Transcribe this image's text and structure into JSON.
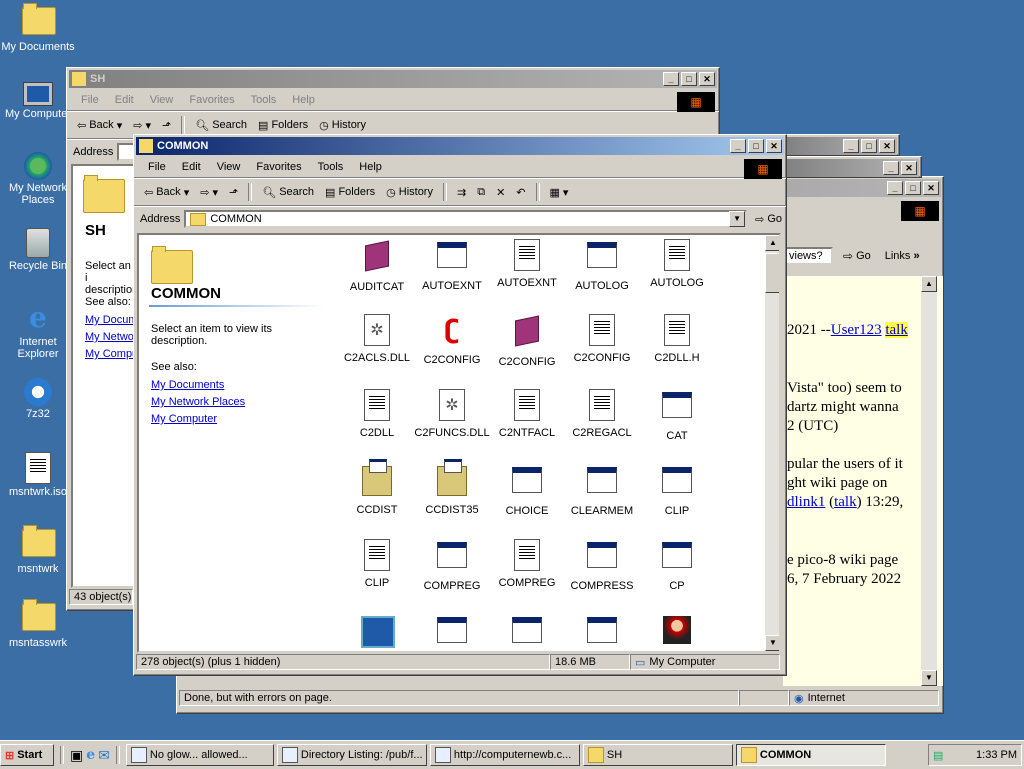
{
  "desktop_icons": [
    {
      "label": "My Documents",
      "icon": "folder-docs-icon"
    },
    {
      "label": "My Computer",
      "icon": "computer-icon"
    },
    {
      "label": "My Network Places",
      "icon": "network-icon"
    },
    {
      "label": "Recycle Bin",
      "icon": "recycle-bin-icon"
    },
    {
      "label": "Internet Explorer",
      "icon": "ie-icon"
    },
    {
      "label": "7z32",
      "icon": "installer-icon"
    },
    {
      "label": "msntwrk.iso",
      "icon": "iso-icon"
    },
    {
      "label": "msntwrk",
      "icon": "folder-icon"
    },
    {
      "label": "msntasswrk",
      "icon": "folder-icon"
    }
  ],
  "sh_window": {
    "title": "SH",
    "menu": [
      "File",
      "Edit",
      "View",
      "Favorites",
      "Tools",
      "Help"
    ],
    "toolbar": {
      "back": "Back",
      "search": "Search",
      "folders": "Folders",
      "history": "History"
    },
    "address_label": "Address",
    "panel_title": "SH",
    "panel_desc": "Select an i description",
    "see_also": "See also:",
    "links": [
      "My Docum",
      "My Netwo",
      "My Compu"
    ],
    "status": "43 object(s)"
  },
  "browser_window": {
    "address_hint": "views?",
    "go": "Go",
    "links": "Links",
    "text_lines": [
      {
        "pre": "2021 --",
        "link": "User123",
        "post": " ",
        "talk": "talk"
      },
      {
        "pre": "Vista\" too) seem to"
      },
      {
        "pre": "dartz might wanna"
      },
      {
        "pre": "2 (UTC)"
      },
      {
        "pre": "pular the users of it"
      },
      {
        "pre": "ght wiki page on"
      },
      {
        "pre": "",
        "link": "dlink1",
        "post": " (",
        "talk": "talk",
        "post2": ") 13:29,"
      },
      {
        "pre": "e pico-8 wiki page"
      },
      {
        "pre": "6, 7 February 2022"
      }
    ],
    "status": "Done, but with errors on page.",
    "zone": "Internet"
  },
  "common_window": {
    "title": "COMMON",
    "menu": [
      "File",
      "Edit",
      "View",
      "Favorites",
      "Tools",
      "Help"
    ],
    "toolbar": {
      "back": "Back",
      "search": "Search",
      "folders": "Folders",
      "history": "History"
    },
    "address_label": "Address",
    "address_value": "COMMON",
    "go": "Go",
    "panel_title": "COMMON",
    "panel_desc": "Select an item to view its description.",
    "see_also": "See also:",
    "links": [
      "My Documents",
      "My Network Places",
      "My Computer"
    ],
    "files": [
      {
        "name": "AUDITCAT",
        "type": "book"
      },
      {
        "name": "AUTOEXNT",
        "type": "app"
      },
      {
        "name": "AUTOEXNT",
        "type": "doc"
      },
      {
        "name": "AUTOLOG",
        "type": "app"
      },
      {
        "name": "AUTOLOG",
        "type": "doc"
      },
      {
        "name": "C2ACLS.DLL",
        "type": "gear"
      },
      {
        "name": "C2CONFIG",
        "type": "c2"
      },
      {
        "name": "C2CONFIG",
        "type": "book"
      },
      {
        "name": "C2CONFIG",
        "type": "doc"
      },
      {
        "name": "C2DLL.H",
        "type": "doc"
      },
      {
        "name": "C2DLL",
        "type": "doc"
      },
      {
        "name": "C2FUNCS.DLL",
        "type": "gear"
      },
      {
        "name": "C2NTFACL",
        "type": "doc"
      },
      {
        "name": "C2REGACL",
        "type": "doc"
      },
      {
        "name": "CAT",
        "type": "app"
      },
      {
        "name": "CCDIST",
        "type": "box"
      },
      {
        "name": "CCDIST35",
        "type": "box"
      },
      {
        "name": "CHOICE",
        "type": "app"
      },
      {
        "name": "CLEARMEM",
        "type": "app"
      },
      {
        "name": "CLIP",
        "type": "app"
      },
      {
        "name": "CLIP",
        "type": "doc"
      },
      {
        "name": "COMPREG",
        "type": "app"
      },
      {
        "name": "COMPREG",
        "type": "doc"
      },
      {
        "name": "COMPRESS",
        "type": "app"
      },
      {
        "name": "CP",
        "type": "app"
      },
      {
        "name": "",
        "type": "cubes"
      },
      {
        "name": "",
        "type": "app"
      },
      {
        "name": "",
        "type": "app"
      },
      {
        "name": "",
        "type": "app"
      },
      {
        "name": "",
        "type": "person"
      }
    ],
    "status_objects": "278 object(s) (plus 1 hidden)",
    "status_size": "18.6 MB",
    "status_zone": "My Computer"
  },
  "taskbar": {
    "start": "Start",
    "tasks": [
      "No glow... allowed...",
      "Directory Listing: /pub/f...",
      "http://computernewb.c...",
      "SH",
      "COMMON"
    ],
    "active_task": "COMMON",
    "clock": "1:33 PM"
  },
  "colors": {
    "desktop": "#3a6ea5",
    "active_title": "#0a246a",
    "face": "#d4d0c8"
  }
}
